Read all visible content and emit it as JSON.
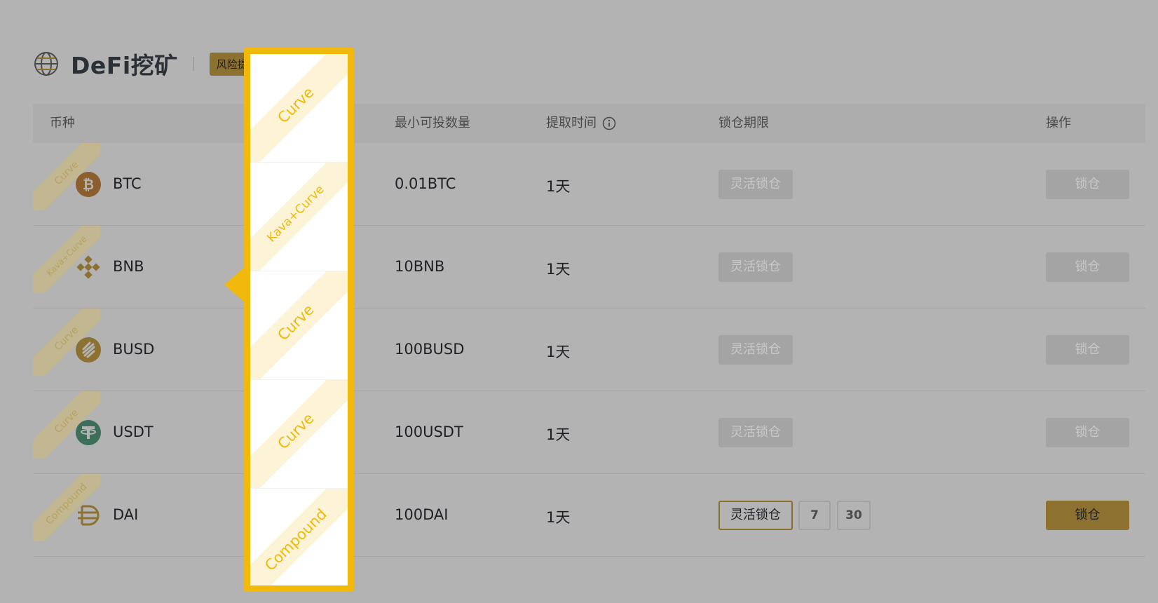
{
  "header": {
    "title": "DeFi挖矿",
    "risk_badge": "风险提示"
  },
  "table": {
    "columns": {
      "coin": "币种",
      "min_amount": "最小可投数量",
      "redeem_time": "提取时间",
      "lock_period": "锁仓期限",
      "action": "操作"
    },
    "rows": [
      {
        "protocol": "Curve",
        "symbol": "BTC",
        "icon": "bitcoin-icon",
        "min_amount": "0.01BTC",
        "redeem_time": "1天",
        "flexible_label": "灵活锁仓",
        "lock_label": "锁仓"
      },
      {
        "protocol": "Kava+Curve",
        "symbol": "BNB",
        "icon": "bnb-icon",
        "min_amount": "10BNB",
        "redeem_time": "1天",
        "flexible_label": "灵活锁仓",
        "lock_label": "锁仓"
      },
      {
        "protocol": "Curve",
        "symbol": "BUSD",
        "icon": "busd-icon",
        "min_amount": "100BUSD",
        "redeem_time": "1天",
        "flexible_label": "灵活锁仓",
        "lock_label": "锁仓"
      },
      {
        "protocol": "Curve",
        "symbol": "USDT",
        "icon": "tether-icon",
        "min_amount": "100USDT",
        "redeem_time": "1天",
        "flexible_label": "灵活锁仓",
        "lock_label": "锁仓"
      },
      {
        "protocol": "Compound",
        "symbol": "DAI",
        "icon": "dai-icon",
        "min_amount": "100DAI",
        "redeem_time": "1天",
        "flexible_label": "灵活锁仓",
        "day_options": [
          "7",
          "30"
        ],
        "lock_label": "锁仓"
      }
    ]
  },
  "spotlight": {
    "labels": [
      "Curve",
      "Kava+Curve",
      "Curve",
      "Curve",
      "Compound"
    ]
  },
  "colors": {
    "accent": "#f0b90b",
    "overlay": "#b3b3b3",
    "ribbon_fill": "#fdf3d6"
  }
}
